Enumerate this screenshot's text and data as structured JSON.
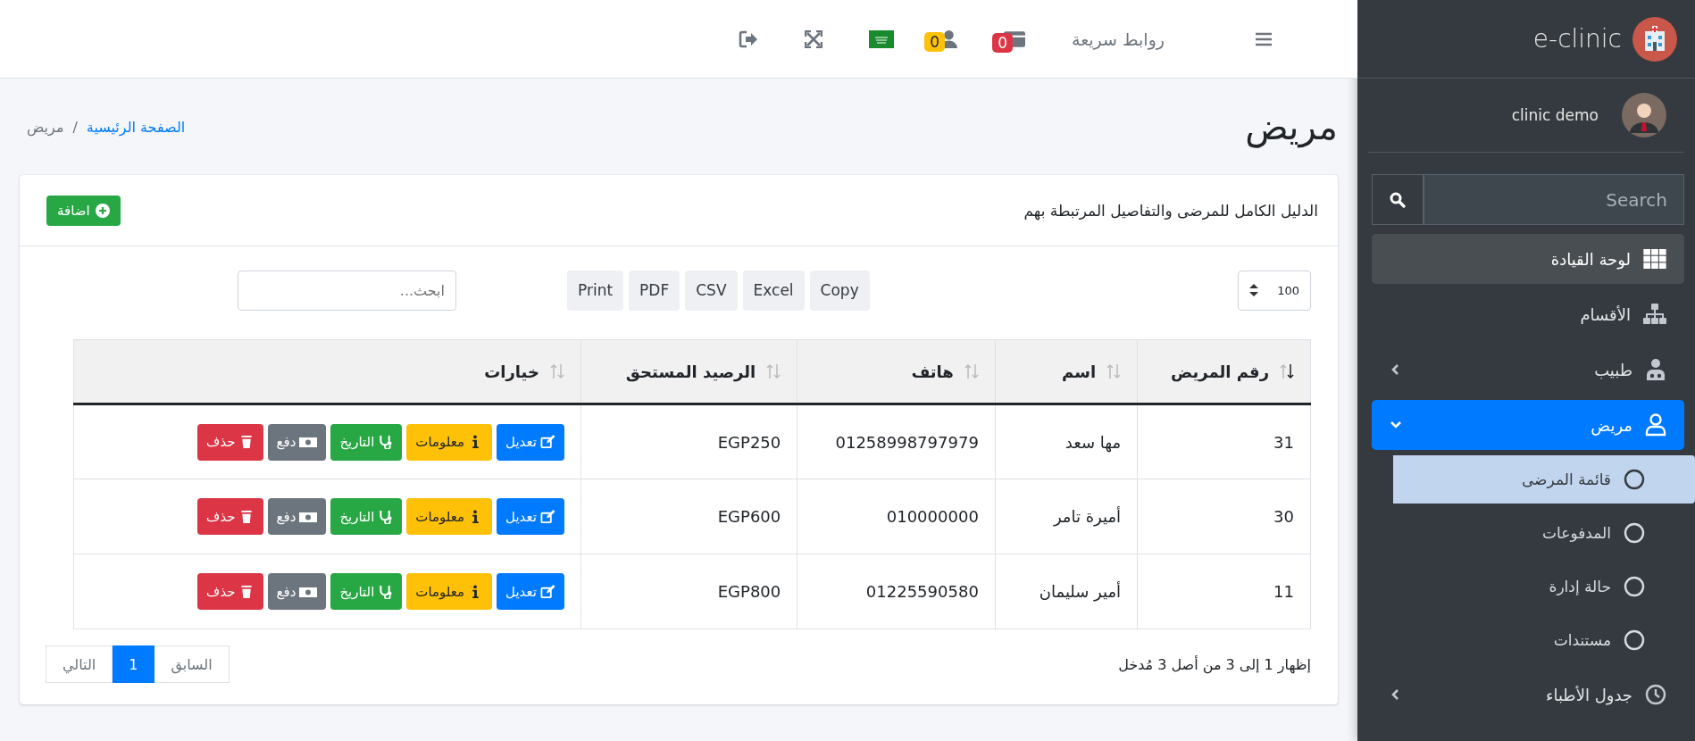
{
  "sidebar": {
    "brand": "e-clinic",
    "user": "clinic demo",
    "search": {
      "placeholder": "Search"
    },
    "items": [
      {
        "label": "لوحة القيادة",
        "kind": "grid",
        "selected": false,
        "hovered": true
      },
      {
        "label": "الأقسام",
        "kind": "sitemap",
        "selected": false,
        "hovered": false
      },
      {
        "label": "طبيب",
        "kind": "doctor",
        "selected": false,
        "hovered": false,
        "expanded": false
      },
      {
        "label": "مريض",
        "kind": "user",
        "selected": true,
        "hovered": false,
        "expanded": true,
        "children": [
          {
            "label": "قائمة المرضى",
            "selected": true
          },
          {
            "label": "المدفوعات",
            "selected": false
          },
          {
            "label": "حالة إدارة",
            "selected": false
          },
          {
            "label": "مستندات",
            "selected": false
          }
        ]
      },
      {
        "label": "جدول الأطباء",
        "kind": "clock",
        "selected": false,
        "hovered": false,
        "expanded": false
      }
    ]
  },
  "topbar": {
    "quick_links": "روابط سريعة",
    "badges": [
      {
        "kind": "card",
        "count": "0",
        "color": "#dc3545"
      },
      {
        "kind": "users",
        "count": "0",
        "color": "#ffc107"
      }
    ]
  },
  "page": {
    "title": "مريض",
    "breadcrumb_separator": "/",
    "breadcrumb": [
      {
        "label": "الصفحة الرئيسية",
        "link": true
      },
      {
        "label": "مريض",
        "link": false
      }
    ]
  },
  "card": {
    "description": "الدليل الكامل للمرضى والتفاصيل المرتبطة بهم",
    "add_button": "اضافة",
    "page_length": "100",
    "export_buttons": [
      "Copy",
      "Excel",
      "CSV",
      "PDF",
      "Print"
    ],
    "search": {
      "placeholder": "ابحث..."
    },
    "table": {
      "columns": [
        {
          "label": "رقم المريض",
          "sorted": true
        },
        {
          "label": "اسم",
          "sorted": false
        },
        {
          "label": "هاتف",
          "sorted": false
        },
        {
          "label": "الرصيد المستحق",
          "sorted": false
        },
        {
          "label": "خيارات",
          "sorted": false
        }
      ],
      "rows": [
        {
          "cells": [
            "31",
            "مها سعد",
            "01258998797979",
            "EGP250"
          ],
          "actions": [
            {
              "kind": "edit",
              "label": "تعديل"
            },
            {
              "kind": "info",
              "label": "معلومات"
            },
            {
              "kind": "history",
              "label": "التاريخ"
            },
            {
              "kind": "pay",
              "label": "دفع"
            },
            {
              "kind": "delete",
              "label": "حذف"
            }
          ]
        },
        {
          "cells": [
            "30",
            "أميرة تامر",
            "010000000",
            "EGP600"
          ],
          "actions": [
            {
              "kind": "edit",
              "label": "تعديل"
            },
            {
              "kind": "info",
              "label": "معلومات"
            },
            {
              "kind": "history",
              "label": "التاريخ"
            },
            {
              "kind": "pay",
              "label": "دفع"
            },
            {
              "kind": "delete",
              "label": "حذف"
            }
          ]
        },
        {
          "cells": [
            "11",
            "أمير سليمان",
            "01225590580",
            "EGP800"
          ],
          "actions": [
            {
              "kind": "edit",
              "label": "تعديل"
            },
            {
              "kind": "info",
              "label": "معلومات"
            },
            {
              "kind": "history",
              "label": "التاريخ"
            },
            {
              "kind": "pay",
              "label": "دفع"
            },
            {
              "kind": "delete",
              "label": "حذف"
            }
          ]
        }
      ]
    },
    "info": "إظهار 1 إلى 3 من أصل 3 مُدخل",
    "pagination": [
      {
        "label": "السابق",
        "selected": false
      },
      {
        "label": "1",
        "selected": true
      },
      {
        "label": "التالي",
        "selected": false
      }
    ]
  }
}
